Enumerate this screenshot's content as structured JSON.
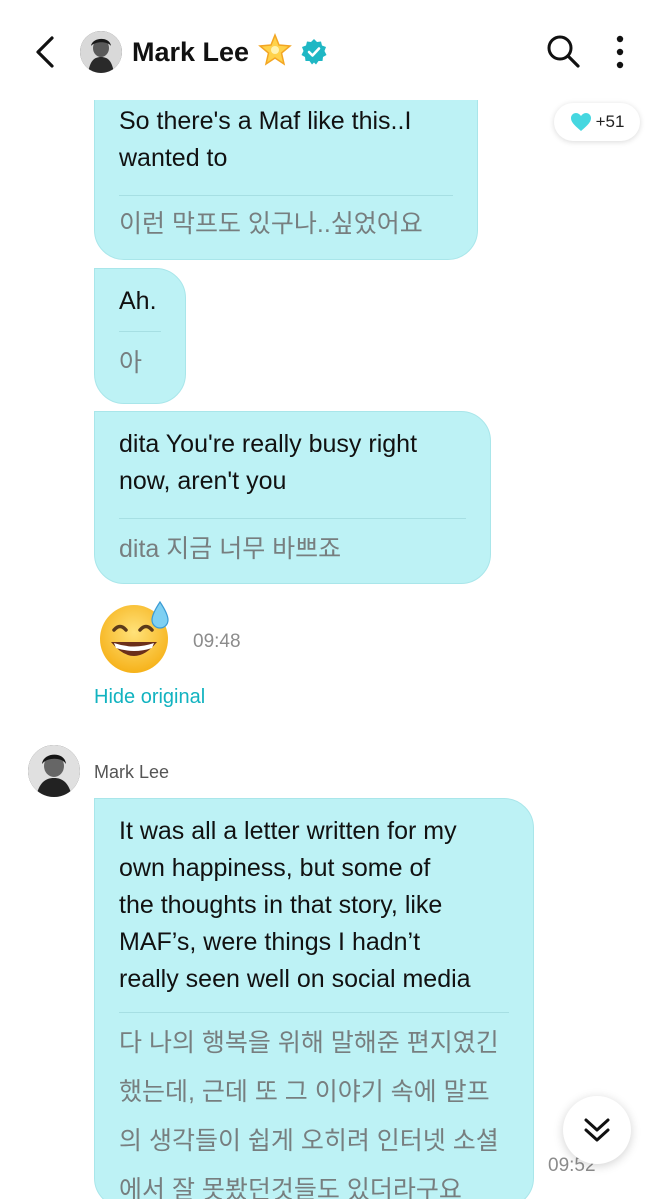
{
  "header": {
    "name": "Mark Lee",
    "icons": [
      "back-icon",
      "star-icon",
      "verified-icon",
      "search-icon",
      "more-icon"
    ]
  },
  "reaction": {
    "icon": "heart-icon",
    "count": "+51",
    "color": "#45d7e0"
  },
  "messages": [
    {
      "en": [
        "So there's a Maf like this..I",
        "wanted to"
      ],
      "ko": [
        "이런 막프도 있구나..싶었어요"
      ]
    },
    {
      "en": [
        "Ah."
      ],
      "ko": [
        "아"
      ]
    },
    {
      "en": [
        "dita You're really busy right",
        "now, aren't you"
      ],
      "ko": [
        "dita 지금 너무 바쁘죠"
      ]
    }
  ],
  "emoji_message": {
    "emoji": "😅",
    "time": "09:48"
  },
  "hide_original": "Hide original",
  "sender": {
    "name": "Mark Lee"
  },
  "reply": {
    "en": [
      "It was all a letter written for my",
      "own happiness, but some of",
      "the thoughts in that story, like",
      "MAF’s, were things I hadn’t",
      "really seen well on social media"
    ],
    "ko": [
      "다 나의 행복을 위해 말해준 편지였긴",
      "했는데, 근데 또 그 이야기 속에 말프",
      "의 생각들이 쉽게 오히려 인터넷 소셜",
      "에서 잘 못봤던것들도 있더라구요"
    ],
    "time": "09:52"
  },
  "colors": {
    "bubble": "#bdf2f5",
    "accent": "#12b3c0",
    "verified": "#1fb7c4"
  }
}
